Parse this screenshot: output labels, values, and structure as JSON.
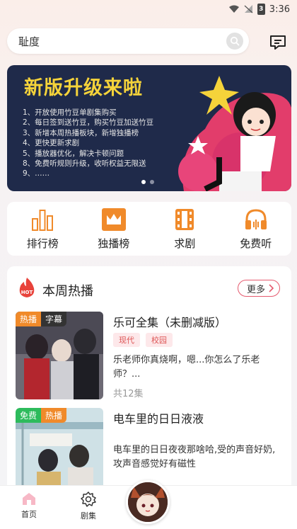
{
  "status": {
    "time": "3:36",
    "battery": "3"
  },
  "search": {
    "placeholder": "耻度"
  },
  "banner": {
    "title": "新版升级来啦",
    "lines": [
      "1、开放使用竹豆单剧集购买",
      "2、每日签到送竹豆，购买竹豆加送竹豆",
      "3、新增本周热播板块，新增独播榜",
      "4、更快更新求剧",
      "5、播放器优化，解决卡顿问题",
      "8、免费听规则升级，收听权益无限送",
      "9、……"
    ],
    "colors": {
      "bg": "#1f2a4a",
      "title": "#f5d33a"
    }
  },
  "quicknav": [
    {
      "label": "排行榜",
      "icon": "bar-chart-icon"
    },
    {
      "label": "独播榜",
      "icon": "crown-icon"
    },
    {
      "label": "求剧",
      "icon": "film-strip-icon"
    },
    {
      "label": "免费听",
      "icon": "headphones-icon"
    }
  ],
  "hot": {
    "title": "本周热播",
    "badge": "HOT",
    "more": "更多",
    "items": [
      {
        "tags": [
          "热播",
          "字幕"
        ],
        "title": "乐可全集（未删减版）",
        "chips": [
          "现代",
          "校园"
        ],
        "desc": "乐老师你真烧啊，嗯...你怎么了乐老师？...",
        "eps": "共12集"
      },
      {
        "tags": [
          "免费",
          "热播"
        ],
        "title": "电车里的日日液液",
        "desc": "电车里的日日夜夜那啥哈,受的声音好奶,攻声音感觉好有磁性"
      }
    ]
  },
  "tabbar": [
    {
      "label": "首页",
      "icon": "home-icon"
    },
    {
      "label": "剧集",
      "icon": "gear-icon"
    }
  ],
  "accent": "#f08a2a"
}
